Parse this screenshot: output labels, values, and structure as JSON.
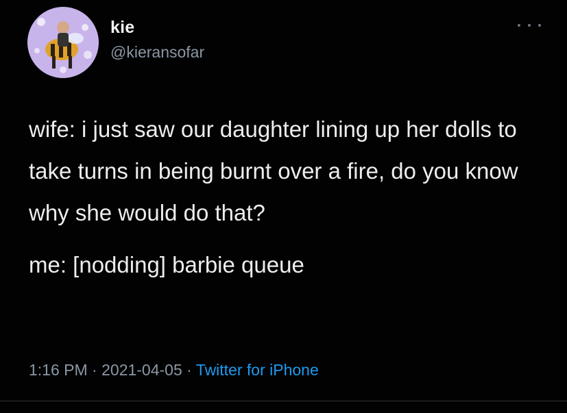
{
  "tweet": {
    "author": {
      "name": "kie",
      "handle": "@kieransofar"
    },
    "text_lines": [
      "wife: i just saw our daughter lining up her dolls to take turns in being burnt over a fire, do you know why she would do that?",
      "me: [nodding] barbie queue"
    ],
    "time": "1:16 PM",
    "date": "2021-04-05",
    "separator": " · ",
    "source": "Twitter for iPhone"
  },
  "colors": {
    "background": "#020202",
    "text": "#ededed",
    "muted": "#8b98a5",
    "link": "#1d9bf0"
  }
}
